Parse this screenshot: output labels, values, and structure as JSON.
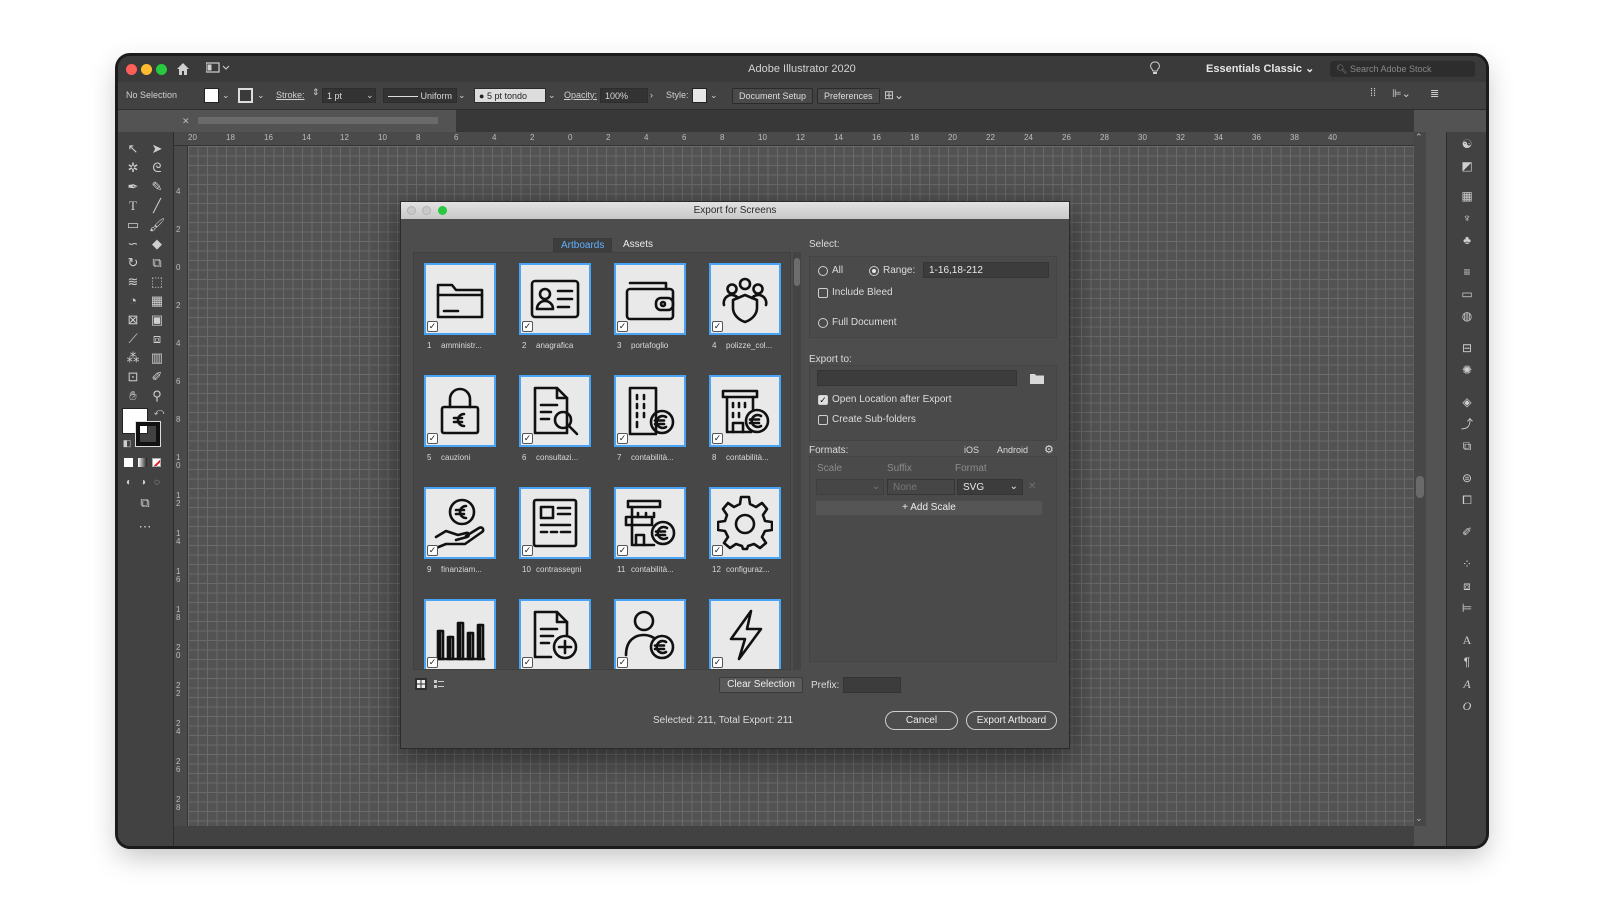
{
  "window": {
    "title": "Adobe Illustrator 2020",
    "workspace": "Essentials Classic",
    "search_placeholder": "Search Adobe Stock"
  },
  "control_bar": {
    "selection": "No Selection",
    "stroke_label": "Stroke:",
    "stroke_value": "1 pt",
    "profile": "Uniform",
    "brush": "5 pt tondo",
    "opacity_label": "Opacity:",
    "opacity_value": "100%",
    "style_label": "Style:",
    "document_setup": "Document Setup",
    "preferences": "Preferences"
  },
  "rulers": {
    "h": [
      "20",
      "18",
      "16",
      "14",
      "12",
      "10",
      "8",
      "6",
      "4",
      "2",
      "0",
      "2",
      "4",
      "6",
      "8",
      "10",
      "12",
      "14",
      "16",
      "18",
      "20",
      "22",
      "24",
      "26",
      "28",
      "30",
      "32",
      "34",
      "36",
      "38",
      "40"
    ],
    "v": [
      "4",
      "2",
      "0",
      "2",
      "4",
      "6",
      "8",
      "1\n0",
      "1\n2",
      "1\n4",
      "1\n6",
      "1\n8",
      "2\n0",
      "2\n2",
      "2\n4",
      "2\n6",
      "2\n8"
    ]
  },
  "dialog": {
    "title": "Export for Screens",
    "tabs": [
      "Artboards",
      "Assets"
    ],
    "artboards": [
      {
        "num": "1",
        "name": "amministr...",
        "icon": "folder-icon"
      },
      {
        "num": "2",
        "name": "anagrafica",
        "icon": "id-card-icon"
      },
      {
        "num": "3",
        "name": "portafoglio",
        "icon": "wallet-icon"
      },
      {
        "num": "4",
        "name": "polizze_col...",
        "icon": "group-shield-icon"
      },
      {
        "num": "5",
        "name": "cauzioni",
        "icon": "lock-euro-icon"
      },
      {
        "num": "6",
        "name": "consultazi...",
        "icon": "document-search-icon"
      },
      {
        "num": "7",
        "name": "contabilità...",
        "icon": "building-euro-icon"
      },
      {
        "num": "8",
        "name": "contabilità...",
        "icon": "bank-euro-icon"
      },
      {
        "num": "9",
        "name": "finanziam...",
        "icon": "hand-coin-icon"
      },
      {
        "num": "10",
        "name": "contrassegni",
        "icon": "voucher-icon"
      },
      {
        "num": "11",
        "name": "contabilità...",
        "icon": "shop-euro-icon"
      },
      {
        "num": "12",
        "name": "configuraz...",
        "icon": "gear-icon"
      },
      {
        "num": "",
        "name": "",
        "icon": "bar-chart-icon"
      },
      {
        "num": "",
        "name": "",
        "icon": "document-add-icon"
      },
      {
        "num": "",
        "name": "",
        "icon": "user-euro-icon"
      },
      {
        "num": "",
        "name": "",
        "icon": "lightning-icon"
      }
    ],
    "select_label": "Select:",
    "all_label": "All",
    "range_label": "Range:",
    "range_value": "1-16,18-212",
    "include_bleed": "Include Bleed",
    "full_document": "Full Document",
    "export_to_label": "Export to:",
    "open_location": "Open Location after Export",
    "create_subfolders": "Create Sub-folders",
    "formats_label": "Formats:",
    "ios": "iOS",
    "android": "Android",
    "col_scale": "Scale",
    "col_suffix": "Suffix",
    "col_format": "Format",
    "suffix_placeholder": "None",
    "format_value": "SVG",
    "add_scale": "+ Add Scale",
    "clear_selection": "Clear Selection",
    "prefix_label": "Prefix:",
    "summary": "Selected: 211, Total Export: 211",
    "cancel": "Cancel",
    "export_artboard": "Export Artboard"
  }
}
